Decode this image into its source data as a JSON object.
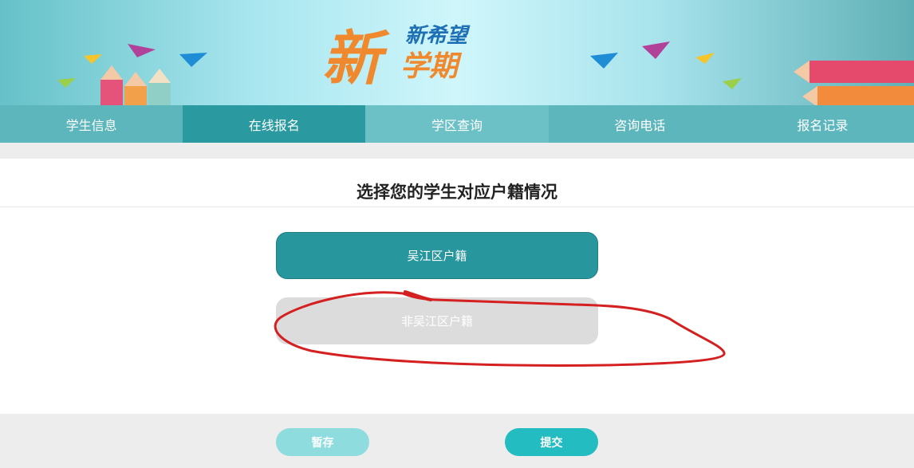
{
  "banner": {
    "logo_big": "新",
    "logo_line1": "新希望",
    "logo_line2": "学期"
  },
  "nav": {
    "items": [
      {
        "label": "学生信息"
      },
      {
        "label": "在线报名"
      },
      {
        "label": "学区查询"
      },
      {
        "label": "咨询电话"
      },
      {
        "label": "报名记录"
      }
    ]
  },
  "main": {
    "title": "选择您的学生对应户籍情况",
    "options": [
      {
        "label": "吴江区户籍"
      },
      {
        "label": "非吴江区户籍"
      }
    ]
  },
  "footer": {
    "save_label": "暂存",
    "submit_label": "提交"
  },
  "colors": {
    "primary": "#27979d",
    "nav_bg": "#5db6bc",
    "nav_active": "#2a9aa0",
    "option_inactive": "#dcdcdc",
    "save_button": "#8fdcdf",
    "submit_button": "#22bcc1",
    "annotation_red": "#d42020"
  }
}
